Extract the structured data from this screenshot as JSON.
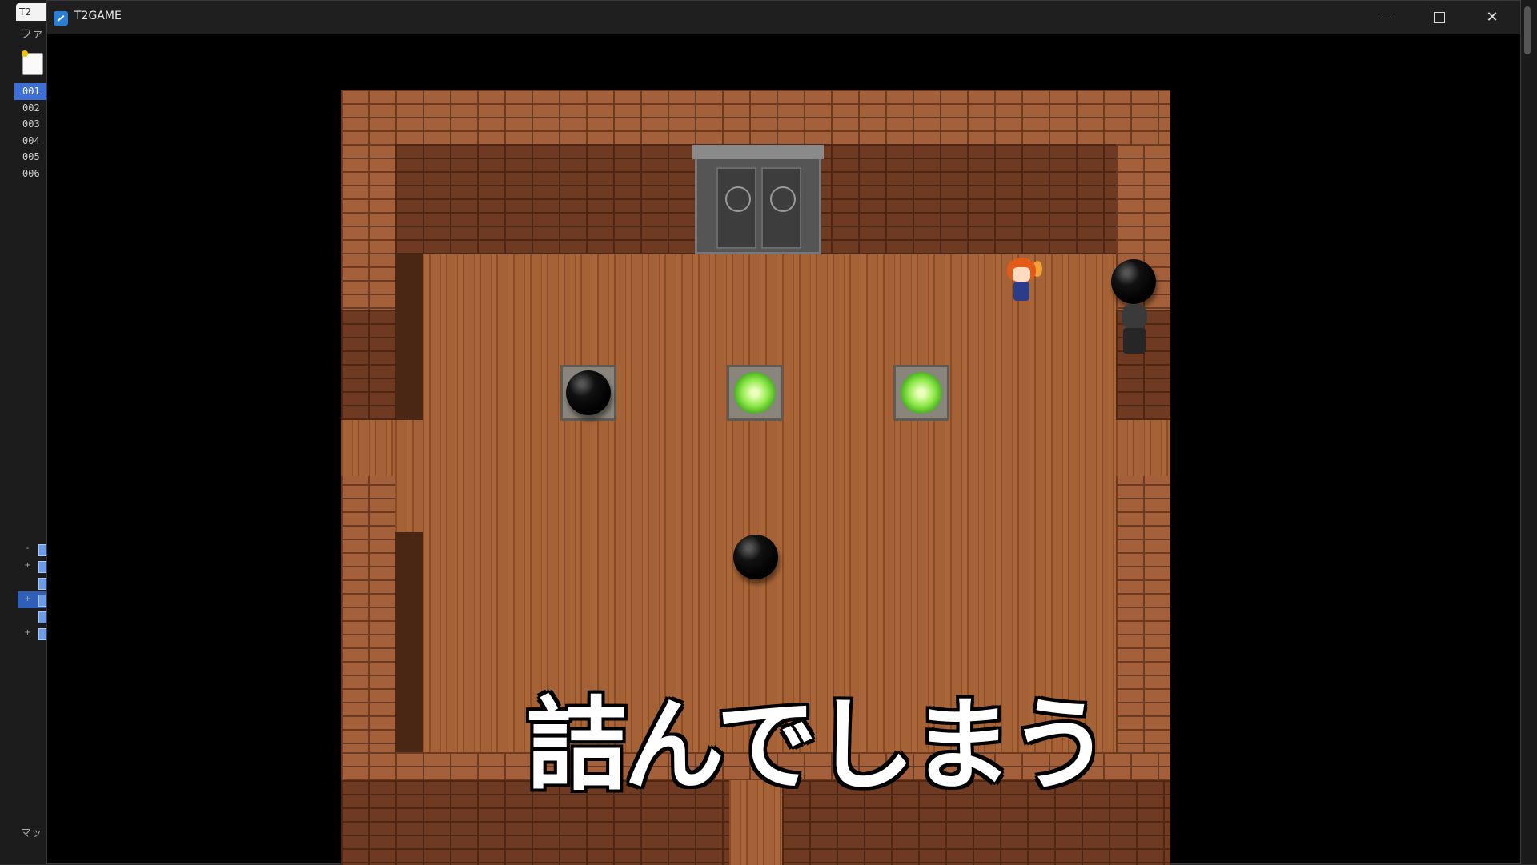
{
  "editor": {
    "tab_label": "T2",
    "menu_label": "ファ",
    "lines": [
      "001",
      "002",
      "003",
      "004",
      "005",
      "006"
    ],
    "selected_line": "001",
    "tree_rows": [
      "-",
      "+",
      "",
      "+",
      "",
      "+"
    ],
    "footer_label": "マッ"
  },
  "window": {
    "title": "T2GAME",
    "minimize_symbol": "",
    "maximize_symbol": "",
    "close_symbol": "✕"
  },
  "game": {
    "caption": "詰んでしまう",
    "plates": [
      {
        "state": "boulder"
      },
      {
        "state": "lit"
      },
      {
        "state": "lit"
      }
    ],
    "colors": {
      "lit_plate": "#8ee84a",
      "brick": "#a3603a",
      "floor": "#9a5a30"
    }
  }
}
